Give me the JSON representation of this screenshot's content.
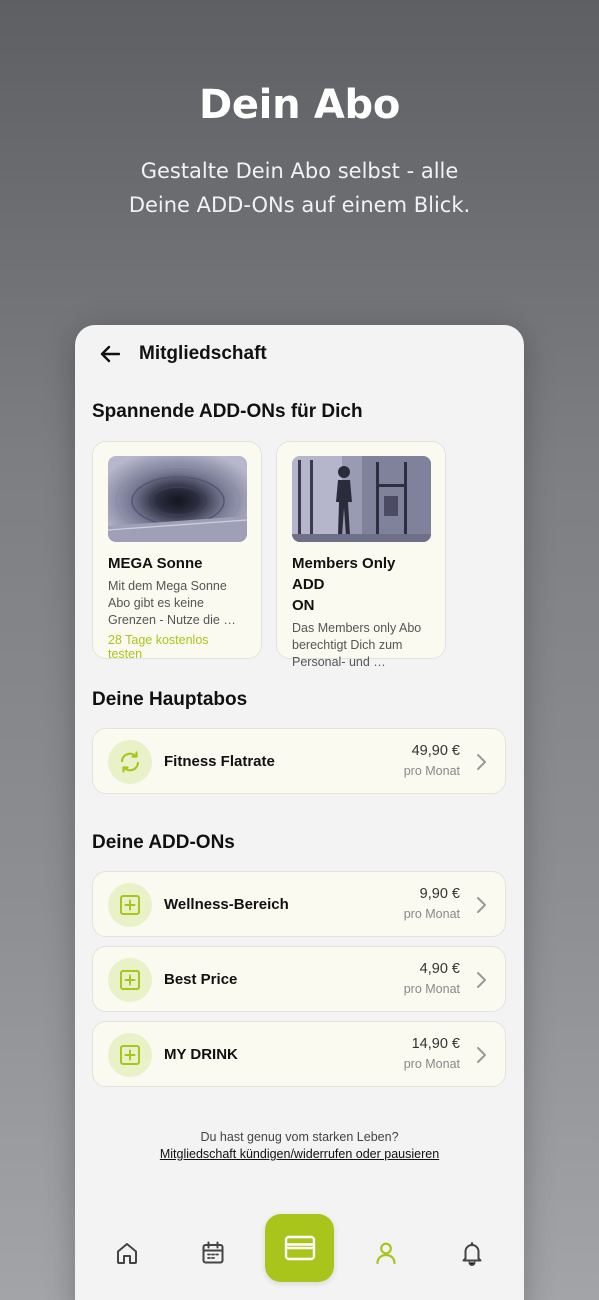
{
  "hero": {
    "title": "Dein Abo",
    "subtitle_line1": "Gestalte Dein Abo selbst - alle",
    "subtitle_line2": "Deine ADD-ONs auf einem Blick."
  },
  "screen": {
    "header_title": "Mitgliedschaft",
    "featured_section_title": "Spannende ADD-ONs für Dich",
    "featured": [
      {
        "title": "MEGA Sonne",
        "desc_line1": "Mit dem Mega Sonne",
        "desc_line2": "Abo gibt es keine",
        "desc_line3": "Grenzen - Nutze die …",
        "cta": "28 Tage kostenlos testen"
      },
      {
        "title_line1": "Members Only ADD",
        "title_line2": "ON",
        "desc_line1": "Das Members only Abo",
        "desc_line2": "berechtigt Dich zum",
        "desc_line3": "Personal- und …"
      }
    ],
    "main_section_title": "Deine Hauptabos",
    "main_subs": [
      {
        "name": "Fitness Flatrate",
        "price": "49,90 €",
        "period": "pro Monat",
        "icon": "refresh-icon"
      }
    ],
    "addons_section_title": "Deine ADD-ONs",
    "addons": [
      {
        "name": "Wellness-Bereich",
        "price": "9,90 €",
        "period": "pro Monat",
        "icon": "plus-square-icon"
      },
      {
        "name": "Best Price",
        "price": "4,90 €",
        "period": "pro Monat",
        "icon": "plus-square-icon"
      },
      {
        "name": "MY DRINK",
        "price": "14,90 €",
        "period": "pro Monat",
        "icon": "plus-square-icon"
      }
    ],
    "footer_question": "Du hast genug vom starken Leben?",
    "footer_link": "Mitgliedschaft kündigen/widerrufen oder pausieren"
  },
  "nav": {
    "items": [
      "home-icon",
      "calendar-icon",
      "card-icon",
      "profile-icon",
      "bell-icon"
    ],
    "active": "card-icon"
  },
  "colors": {
    "accent": "#a9c51b",
    "accent_light": "#e9f1c8",
    "card_bg": "#fafaf1",
    "screen_bg": "#f3f3f3"
  }
}
